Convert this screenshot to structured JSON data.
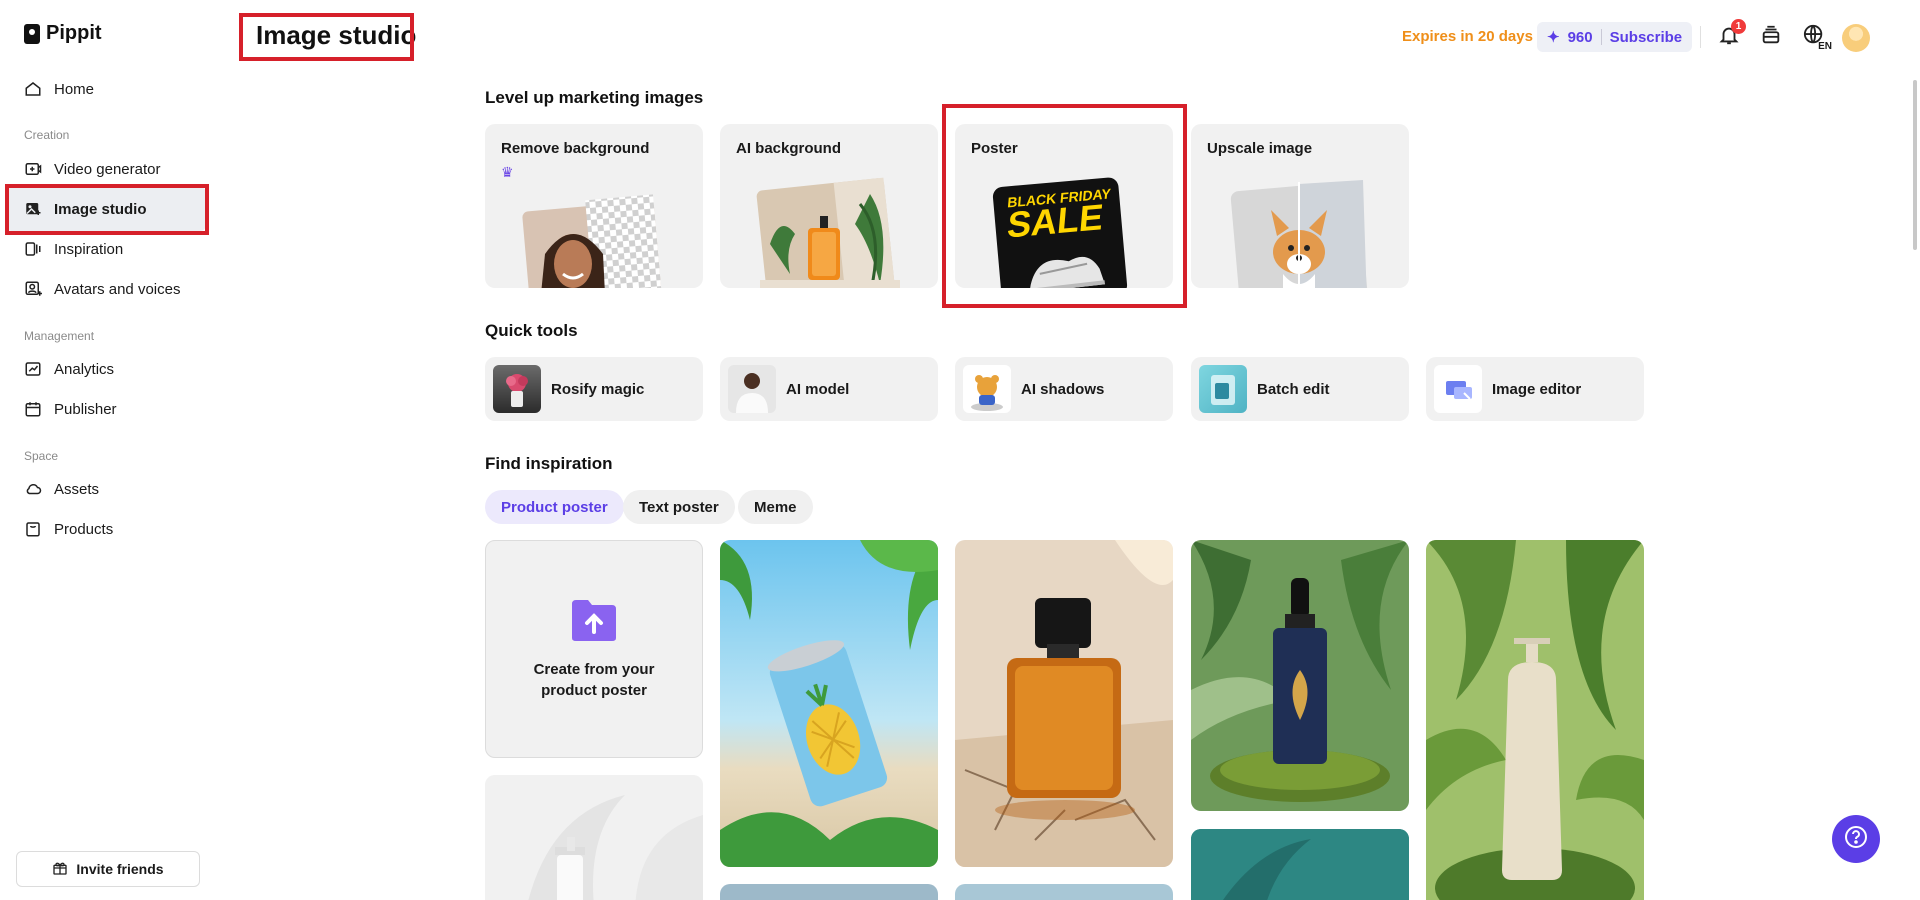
{
  "app": {
    "name": "Pippit"
  },
  "header": {
    "title": "Image studio",
    "expires": "Expires in 20 days",
    "credits": "960",
    "subscribe": "Subscribe",
    "notification_count": "1",
    "language": "EN"
  },
  "sidebar": {
    "home": "Home",
    "section_creation": "Creation",
    "items_creation": [
      "Video generator",
      "Image studio",
      "Inspiration",
      "Avatars and voices"
    ],
    "section_management": "Management",
    "items_management": [
      "Analytics",
      "Publisher"
    ],
    "section_space": "Space",
    "items_space": [
      "Assets",
      "Products"
    ],
    "invite": "Invite friends"
  },
  "marketing": {
    "title": "Level up marketing images",
    "cards": [
      "Remove background",
      "AI background",
      "Poster",
      "Upscale image"
    ],
    "poster_text_1": "BLACK FRIDAY",
    "poster_text_2": "SALE"
  },
  "quick_tools": {
    "title": "Quick tools",
    "items": [
      "Rosify magic",
      "AI model",
      "AI shadows",
      "Batch edit",
      "Image editor"
    ]
  },
  "inspiration": {
    "title": "Find inspiration",
    "chips": [
      "Product poster",
      "Text poster",
      "Meme"
    ],
    "create_card": "Create from your product poster"
  },
  "colors": {
    "accent": "#5b3ee6",
    "highlight": "#d6202a",
    "warning": "#ef8f1a"
  }
}
